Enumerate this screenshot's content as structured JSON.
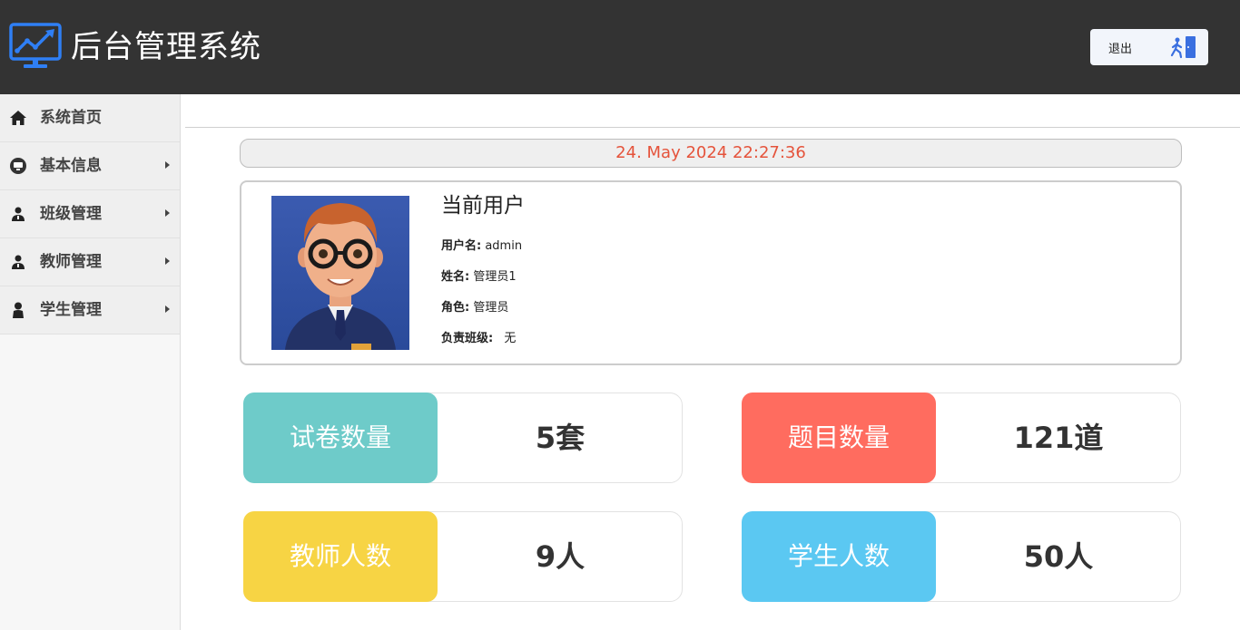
{
  "header": {
    "title": "后台管理系统",
    "logout_label": "退出"
  },
  "sidebar": {
    "items": [
      {
        "label": "系统首页",
        "icon": "home-icon",
        "has_submenu": false
      },
      {
        "label": "基本信息",
        "icon": "info-icon",
        "has_submenu": true
      },
      {
        "label": "班级管理",
        "icon": "users-icon",
        "has_submenu": true
      },
      {
        "label": "教师管理",
        "icon": "users-icon",
        "has_submenu": true
      },
      {
        "label": "学生管理",
        "icon": "user-icon",
        "has_submenu": true
      }
    ]
  },
  "main": {
    "datetime": "24. May 2024 22:27:36",
    "user_card": {
      "title": "当前用户",
      "username_label": "用户名:",
      "username": "admin",
      "name_label": "姓名:",
      "name": "管理员1",
      "role_label": "角色:",
      "role": "管理员",
      "class_label": "负责班级:",
      "class": "无"
    },
    "stats": [
      {
        "label": "试卷数量",
        "value": "5套",
        "color": "#6ecbc9"
      },
      {
        "label": "题目数量",
        "value": "121道",
        "color": "#ff6c5f"
      },
      {
        "label": "教师人数",
        "value": "9人",
        "color": "#f7d444"
      },
      {
        "label": "学生人数",
        "value": "50人",
        "color": "#5bc8f2"
      }
    ]
  },
  "colors": {
    "header_bg": "#333333",
    "accent_blue": "#2f7ff5",
    "date_text": "#e5533b"
  }
}
